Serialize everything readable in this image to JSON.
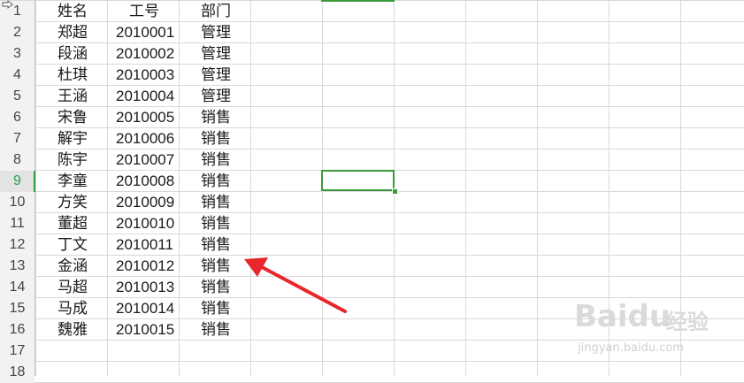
{
  "sheet": {
    "row_numbers": [
      "1",
      "2",
      "3",
      "4",
      "5",
      "6",
      "7",
      "8",
      "9",
      "10",
      "11",
      "12",
      "13",
      "14",
      "15",
      "16",
      "17",
      "18"
    ],
    "active_row": "9",
    "header": {
      "name": "姓名",
      "id": "工号",
      "dept": "部门"
    },
    "rows": [
      {
        "name": "郑超",
        "id": "2010001",
        "dept": "管理"
      },
      {
        "name": "段涵",
        "id": "2010002",
        "dept": "管理"
      },
      {
        "name": "杜琪",
        "id": "2010003",
        "dept": "管理"
      },
      {
        "name": "王涵",
        "id": "2010004",
        "dept": "管理"
      },
      {
        "name": "宋鲁",
        "id": "2010005",
        "dept": "销售"
      },
      {
        "name": "解宇",
        "id": "2010006",
        "dept": "销售"
      },
      {
        "name": "陈宇",
        "id": "2010007",
        "dept": "销售"
      },
      {
        "name": "李童",
        "id": "2010008",
        "dept": "销售"
      },
      {
        "name": "方笑",
        "id": "2010009",
        "dept": "销售"
      },
      {
        "name": "董超",
        "id": "2010010",
        "dept": "销售"
      },
      {
        "name": "丁文",
        "id": "2010011",
        "dept": "销售"
      },
      {
        "name": "金涵",
        "id": "2010012",
        "dept": "销售"
      },
      {
        "name": "马超",
        "id": "2010013",
        "dept": "销售"
      },
      {
        "name": "马成",
        "id": "2010014",
        "dept": "销售"
      },
      {
        "name": "魏雅",
        "id": "2010015",
        "dept": "销售"
      }
    ]
  },
  "watermark": {
    "logo": "Baidu",
    "sub": "经验",
    "url": "jingyan.baidu.com"
  },
  "colors": {
    "selection": "#3c9a3c",
    "arrow": "#e8262b",
    "grid": "#d9d9d9"
  }
}
